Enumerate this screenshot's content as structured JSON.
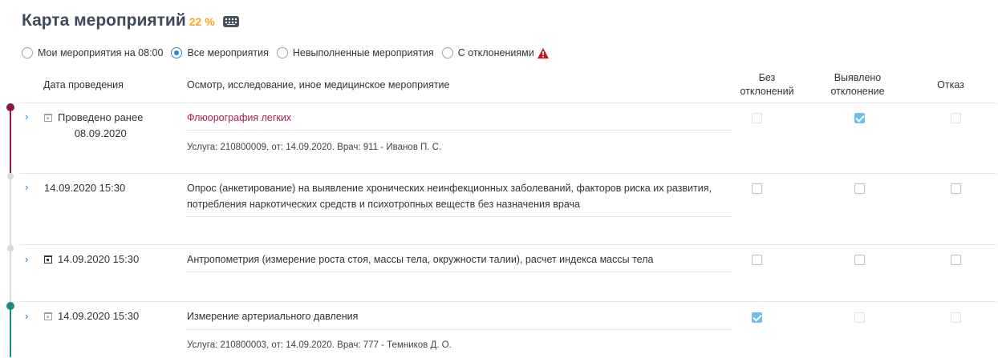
{
  "header": {
    "title": "Карта мероприятий",
    "percent": "22 %"
  },
  "filters": [
    {
      "label": "Мои мероприятия на 08:00",
      "selected": false
    },
    {
      "label": "Все мероприятия",
      "selected": true
    },
    {
      "label": "Невыполненные мероприятия",
      "selected": false
    },
    {
      "label": "С отклонениями",
      "selected": false
    }
  ],
  "table": {
    "columns": {
      "date": "Дата проведения",
      "service": "Осмотр, исследование, иное медицинское мероприятие",
      "no_dev_1": "Без",
      "no_dev_2": "отклонений",
      "dev_1": "Выявлено",
      "dev_2": "отклонение",
      "refuse": "Отказ"
    },
    "rows": [
      {
        "date_line1": "Проведено ранее",
        "date_line2": "08.09.2020",
        "service": "Флюорография легких",
        "meta": "Услуга: 210800009, от: 14.09.2020. Врач: 911 - Иванов П. С.",
        "no_deviation": false,
        "deviation": true,
        "refusal": false
      },
      {
        "date_line1": "14.09.2020 15:30",
        "service": "Опрос (анкетирование) на выявление хронических неинфекционных заболеваний, факторов риска их развития, потребления наркотических средств и психотропных веществ без назначения врача",
        "meta": "",
        "no_deviation": false,
        "deviation": false,
        "refusal": false
      },
      {
        "date_line1": "14.09.2020 15:30",
        "service": "Антропометрия (измерение роста стоя, массы тела, окружности талии), расчет индекса массы тела",
        "meta": "",
        "no_deviation": false,
        "deviation": false,
        "refusal": false
      },
      {
        "date_line1": "14.09.2020 15:30",
        "service": "Измерение артериального давления",
        "meta": "Услуга: 210800003, от: 14.09.2020. Врач: 777 - Темников Д. О.",
        "no_deviation": true,
        "deviation": false,
        "refusal": false
      }
    ]
  },
  "colors": {
    "accent": "#2a86d1",
    "percent": "#f5a623",
    "link": "#a52345",
    "timeline_red": "#8b1a3c",
    "timeline_teal": "#1a8a82",
    "warning": "#c4161c",
    "checked": "#6cc1ec"
  },
  "icons": {
    "keyboard": "keyboard-icon",
    "warning": "warning-triangle-icon",
    "calendar": "calendar-icon",
    "expand": "chevron-right-icon"
  }
}
